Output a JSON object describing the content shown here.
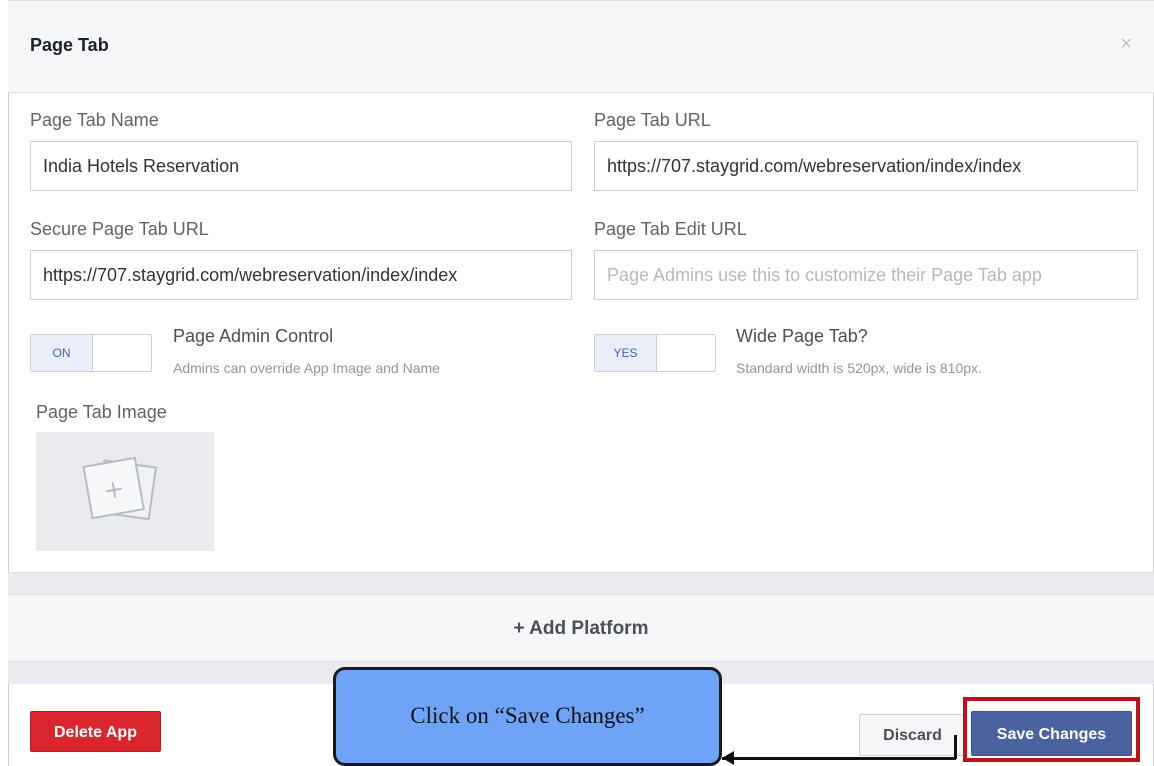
{
  "panel": {
    "title": "Page Tab",
    "close_glyph": "×"
  },
  "fields": {
    "tab_name": {
      "label": "Page Tab Name",
      "value": "India Hotels Reservation"
    },
    "tab_url": {
      "label": "Page Tab URL",
      "value": "https://707.staygrid.com/webreservation/index/index"
    },
    "secure_url": {
      "label": "Secure Page Tab URL",
      "value": "https://707.staygrid.com/webreservation/index/index"
    },
    "edit_url": {
      "label": "Page Tab Edit URL",
      "placeholder": "Page Admins use this to customize their Page Tab app"
    }
  },
  "controls": {
    "admin_control": {
      "toggle": "ON",
      "title": "Page Admin Control",
      "subtitle": "Admins can override App Image and Name"
    },
    "wide_tab": {
      "toggle": "YES",
      "title": "Wide Page Tab?",
      "subtitle": "Standard width is 520px, wide is 810px."
    }
  },
  "image": {
    "label": "Page Tab Image",
    "icon": "add-image-icon"
  },
  "add_platform": "+ Add Platform",
  "footer": {
    "delete_label": "Delete App",
    "discard_label": "Discard",
    "save_label": "Save Changes"
  },
  "callout": "Click on “Save Changes”",
  "colors": {
    "delete": "#d9252b",
    "save": "#4a63a0",
    "highlight": "#c0111a",
    "callout": "#6fa3f7"
  }
}
